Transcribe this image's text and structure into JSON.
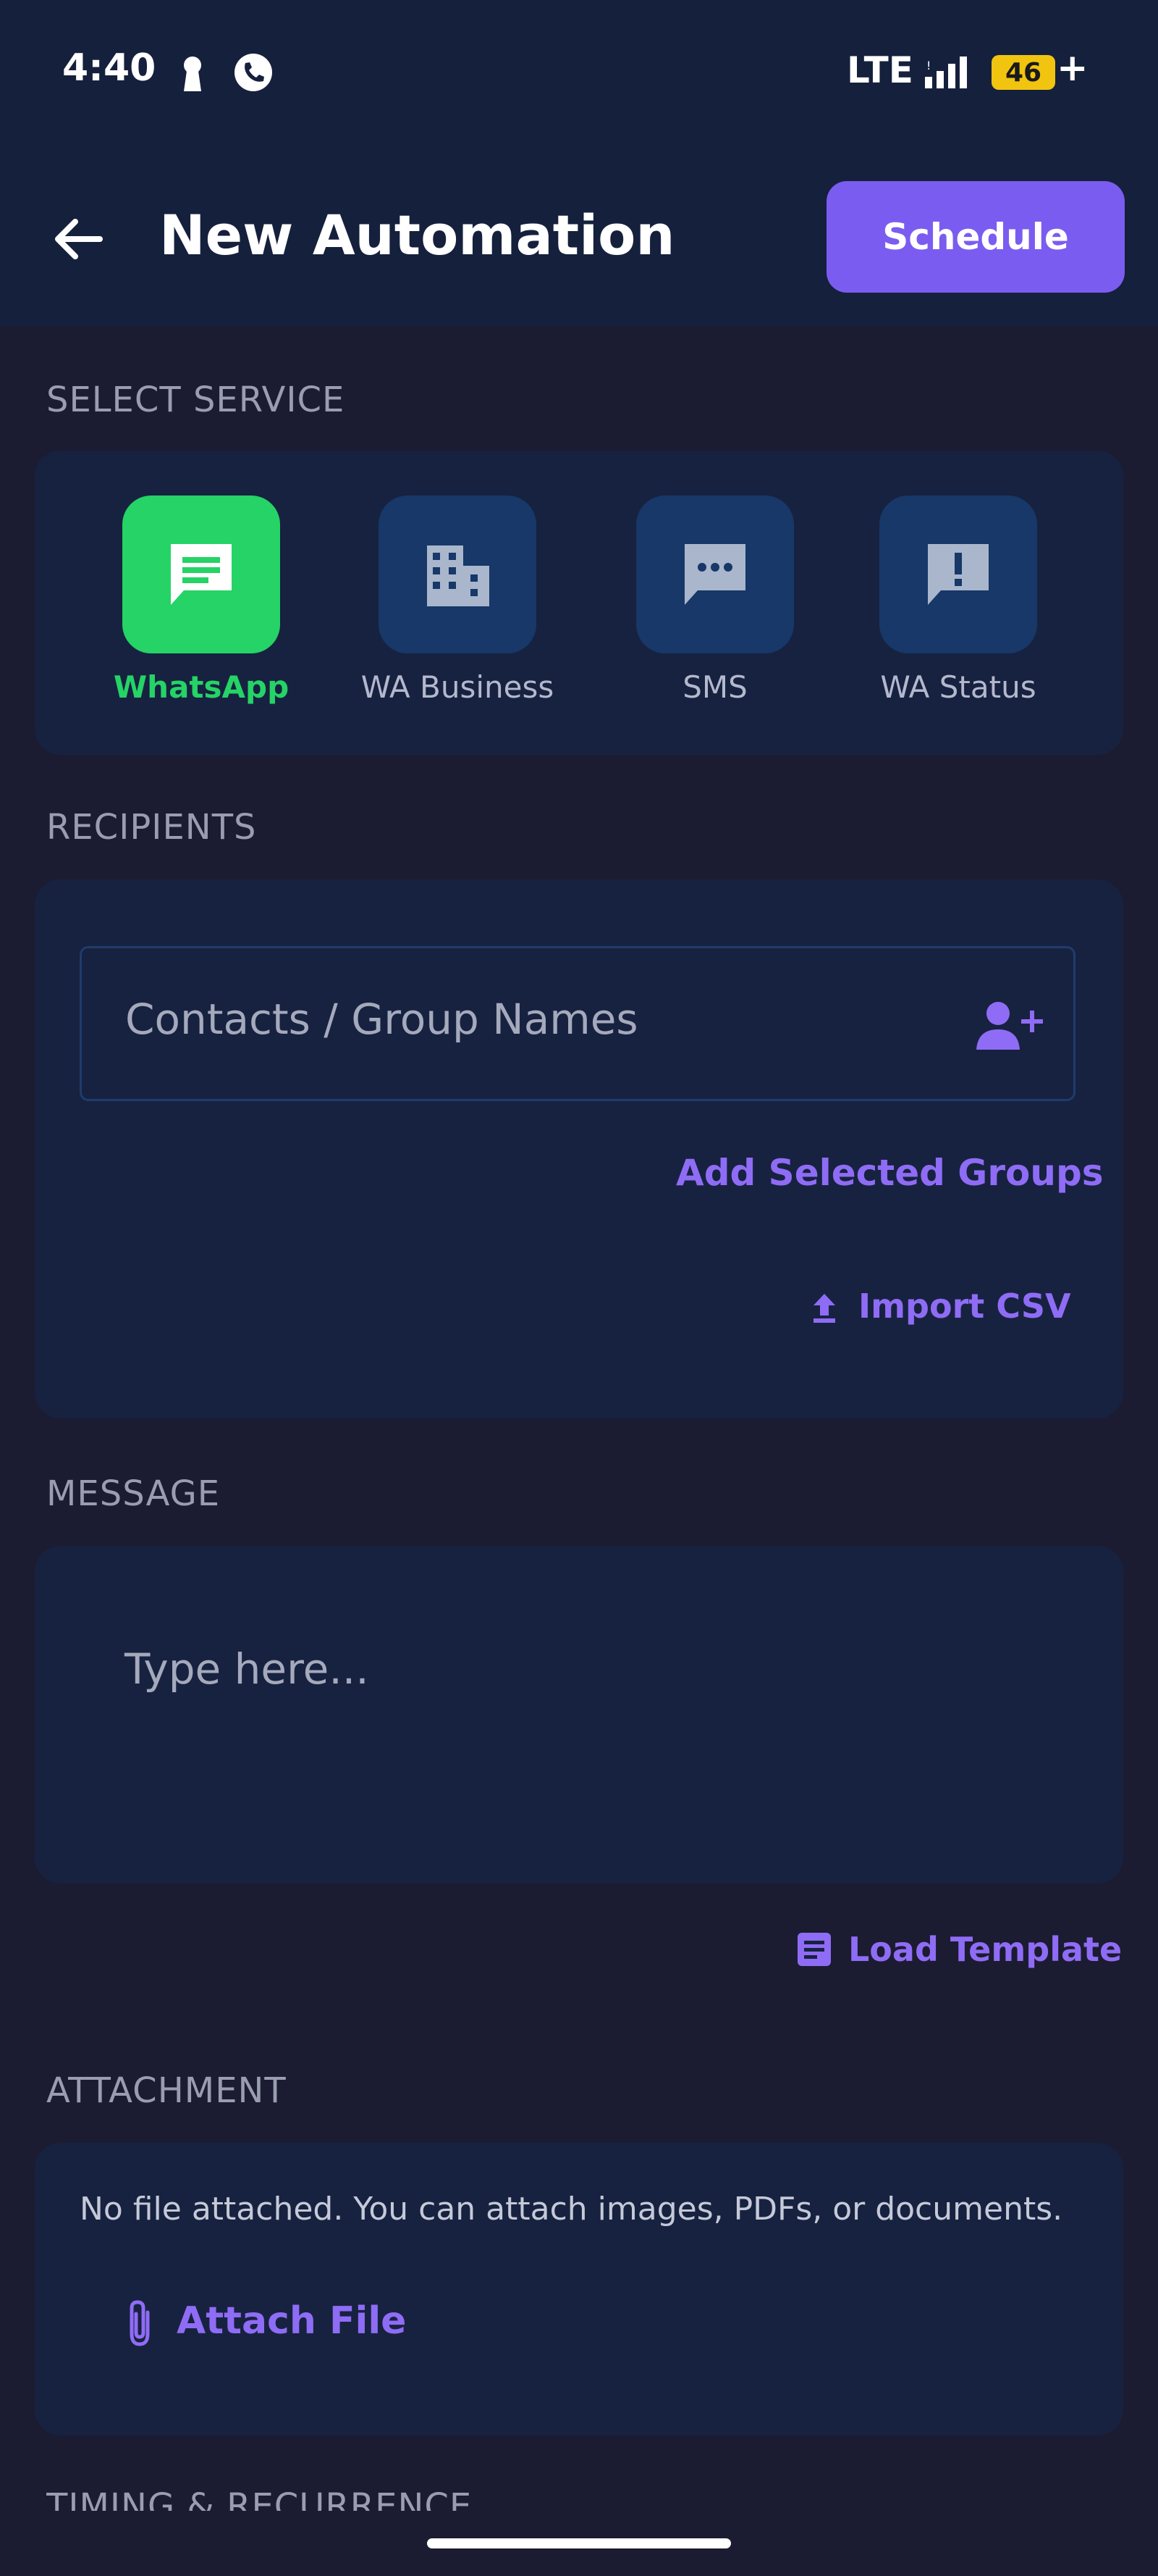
{
  "status_bar": {
    "time": "4:40",
    "network": "LTE",
    "battery": "46",
    "battery_suffix": "+"
  },
  "header": {
    "title": "New Automation",
    "schedule_label": "Schedule"
  },
  "select_service": {
    "label": "SELECT SERVICE",
    "services": [
      {
        "label": "WhatsApp",
        "icon": "message-icon",
        "active": true
      },
      {
        "label": "WA Business",
        "icon": "business-icon",
        "active": false
      },
      {
        "label": "SMS",
        "icon": "sms-icon",
        "active": false
      },
      {
        "label": "WA Status",
        "icon": "status-alert-icon",
        "active": false
      }
    ]
  },
  "recipients": {
    "label": "RECIPIENTS",
    "placeholder": "Contacts / Group Names",
    "add_groups_label": "Add Selected Groups",
    "import_label": "Import CSV"
  },
  "message": {
    "label": "MESSAGE",
    "placeholder": "Type here...",
    "load_template_label": "Load Template"
  },
  "attachment": {
    "label": "ATTACHMENT",
    "note": "No file attached. You can attach images, PDFs, or documents.",
    "attach_label": "Attach File"
  },
  "timing": {
    "label": "TIMING & RECURRENCE"
  },
  "colors": {
    "accent": "#7b5cf0",
    "whatsapp_green": "#25d366",
    "card": "#172240",
    "background": "#1b1c31"
  }
}
